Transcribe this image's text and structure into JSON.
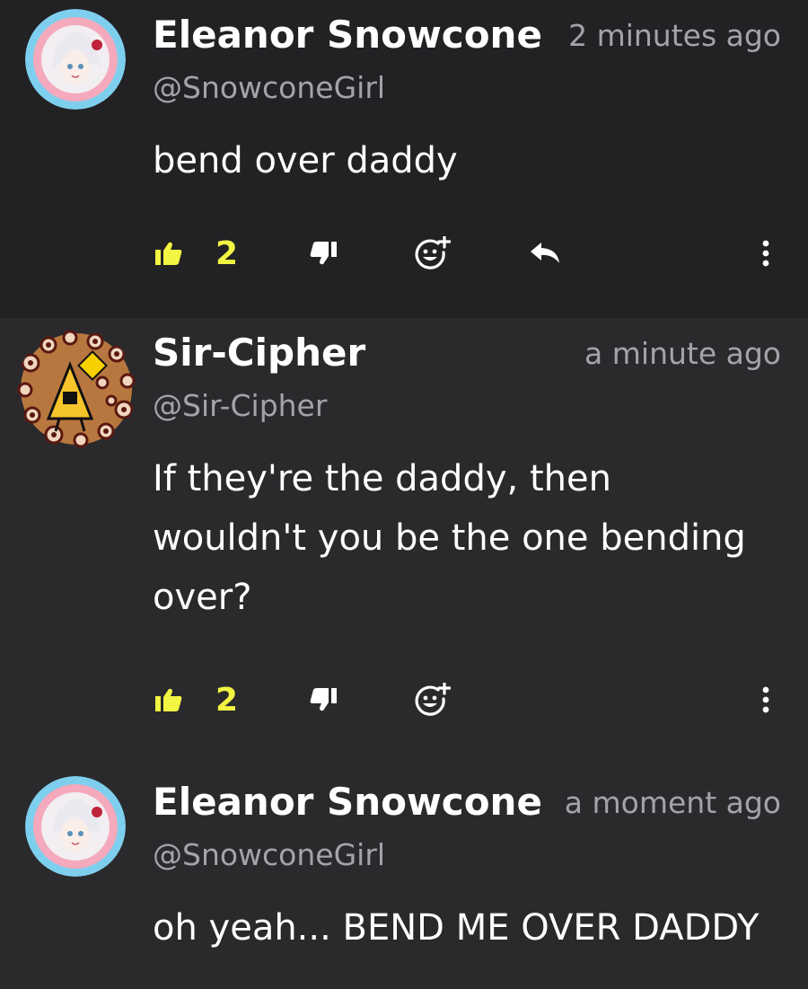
{
  "comments": [
    {
      "author": "Eleanor Snowcone",
      "handle": "@SnowconeGirl",
      "time": "2 minutes ago",
      "body": "bend over daddy",
      "likes": "2",
      "has_reply": true
    },
    {
      "author": "Sir-Cipher",
      "handle": "@Sir-Cipher",
      "time": "a minute ago",
      "body": "If they're the daddy, then wouldn't you be the one bending over?",
      "likes": "2",
      "has_reply": false
    },
    {
      "author": "Eleanor Snowcone",
      "handle": "@SnowconeGirl",
      "time": "a moment ago",
      "body": "oh yeah... BEND ME OVER DADDY"
    }
  ],
  "icons": {
    "like": "thumbs-up-icon",
    "dislike": "thumbs-down-icon",
    "react": "add-reaction-icon",
    "reply": "reply-icon",
    "more": "more-vertical-icon"
  },
  "colors": {
    "like_accent": "#f2f542",
    "text_primary": "#ffffff",
    "text_secondary": "#a3a3aa",
    "bg_dark": "#222225",
    "bg": "#2a2a2d"
  }
}
